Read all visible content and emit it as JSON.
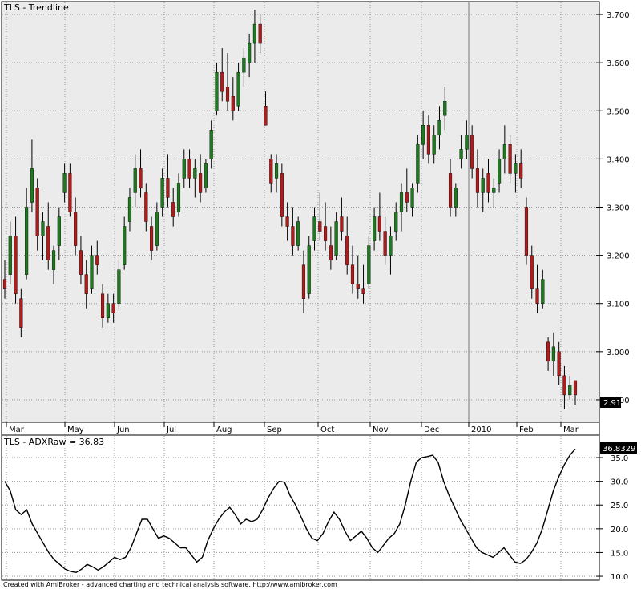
{
  "footer": "Created with AmiBroker - advanced charting and technical analysis software. http://www.amibroker.com",
  "colors": {
    "up": "#1f7a1f",
    "down": "#b01c1c",
    "wick": "#000000",
    "panel": "#ebebeb",
    "grid": "#9a9a9a"
  },
  "chart_data": [
    {
      "type": "candlestick",
      "title": "TLS - Trendline",
      "y_range": [
        2.86,
        3.72
      ],
      "y_ticks": [
        2.9,
        3.0,
        3.1,
        3.2,
        3.3,
        3.4,
        3.5,
        3.6,
        3.7
      ],
      "y_tick_labels": [
        "2.900",
        "3.000",
        "3.100",
        "3.200",
        "3.300",
        "3.400",
        "3.500",
        "3.600",
        "3.700"
      ],
      "x_labels": [
        "Mar",
        "May",
        "Jun",
        "Jul",
        "Aug",
        "Sep",
        "Oct",
        "Nov",
        "Dec",
        "2010",
        "Feb",
        "Mar"
      ],
      "last_value": "2.91",
      "series": [
        {
          "o": 3.15,
          "h": 3.19,
          "l": 3.11,
          "c": 3.13
        },
        {
          "o": 3.16,
          "h": 3.27,
          "l": 3.14,
          "c": 3.24
        },
        {
          "o": 3.24,
          "h": 3.28,
          "l": 3.1,
          "c": 3.12
        },
        {
          "o": 3.11,
          "h": 3.13,
          "l": 3.03,
          "c": 3.05
        },
        {
          "o": 3.16,
          "h": 3.34,
          "l": 3.15,
          "c": 3.3
        },
        {
          "o": 3.31,
          "h": 3.44,
          "l": 3.29,
          "c": 3.38
        },
        {
          "o": 3.34,
          "h": 3.36,
          "l": 3.21,
          "c": 3.24
        },
        {
          "o": 3.24,
          "h": 3.29,
          "l": 3.19,
          "c": 3.27
        },
        {
          "o": 3.26,
          "h": 3.31,
          "l": 3.17,
          "c": 3.19
        },
        {
          "o": 3.17,
          "h": 3.22,
          "l": 3.14,
          "c": 3.21
        },
        {
          "o": 3.22,
          "h": 3.3,
          "l": 3.19,
          "c": 3.28
        },
        {
          "o": 3.33,
          "h": 3.39,
          "l": 3.31,
          "c": 3.37
        },
        {
          "o": 3.37,
          "h": 3.39,
          "l": 3.28,
          "c": 3.29
        },
        {
          "o": 3.29,
          "h": 3.32,
          "l": 3.2,
          "c": 3.22
        },
        {
          "o": 3.21,
          "h": 3.24,
          "l": 3.14,
          "c": 3.16
        },
        {
          "o": 3.16,
          "h": 3.19,
          "l": 3.09,
          "c": 3.12
        },
        {
          "o": 3.13,
          "h": 3.22,
          "l": 3.12,
          "c": 3.2
        },
        {
          "o": 3.2,
          "h": 3.23,
          "l": 3.16,
          "c": 3.18
        },
        {
          "o": 3.12,
          "h": 3.14,
          "l": 3.05,
          "c": 3.07
        },
        {
          "o": 3.07,
          "h": 3.12,
          "l": 3.06,
          "c": 3.1
        },
        {
          "o": 3.1,
          "h": 3.12,
          "l": 3.06,
          "c": 3.08
        },
        {
          "o": 3.1,
          "h": 3.19,
          "l": 3.09,
          "c": 3.17
        },
        {
          "o": 3.18,
          "h": 3.28,
          "l": 3.17,
          "c": 3.26
        },
        {
          "o": 3.27,
          "h": 3.34,
          "l": 3.25,
          "c": 3.32
        },
        {
          "o": 3.33,
          "h": 3.41,
          "l": 3.3,
          "c": 3.38
        },
        {
          "o": 3.38,
          "h": 3.42,
          "l": 3.32,
          "c": 3.34
        },
        {
          "o": 3.33,
          "h": 3.35,
          "l": 3.25,
          "c": 3.27
        },
        {
          "o": 3.26,
          "h": 3.28,
          "l": 3.19,
          "c": 3.21
        },
        {
          "o": 3.22,
          "h": 3.31,
          "l": 3.21,
          "c": 3.29
        },
        {
          "o": 3.3,
          "h": 3.38,
          "l": 3.28,
          "c": 3.36
        },
        {
          "o": 3.36,
          "h": 3.41,
          "l": 3.3,
          "c": 3.32
        },
        {
          "o": 3.31,
          "h": 3.34,
          "l": 3.26,
          "c": 3.28
        },
        {
          "o": 3.29,
          "h": 3.37,
          "l": 3.28,
          "c": 3.35
        },
        {
          "o": 3.36,
          "h": 3.42,
          "l": 3.34,
          "c": 3.4
        },
        {
          "o": 3.4,
          "h": 3.42,
          "l": 3.34,
          "c": 3.36
        },
        {
          "o": 3.36,
          "h": 3.4,
          "l": 3.32,
          "c": 3.38
        },
        {
          "o": 3.37,
          "h": 3.41,
          "l": 3.31,
          "c": 3.33
        },
        {
          "o": 3.34,
          "h": 3.4,
          "l": 3.33,
          "c": 3.39
        },
        {
          "o": 3.4,
          "h": 3.48,
          "l": 3.38,
          "c": 3.46
        },
        {
          "o": 3.5,
          "h": 3.6,
          "l": 3.49,
          "c": 3.58
        },
        {
          "o": 3.58,
          "h": 3.63,
          "l": 3.52,
          "c": 3.54
        },
        {
          "o": 3.55,
          "h": 3.62,
          "l": 3.5,
          "c": 3.52
        },
        {
          "o": 3.53,
          "h": 3.57,
          "l": 3.48,
          "c": 3.5
        },
        {
          "o": 3.51,
          "h": 3.6,
          "l": 3.5,
          "c": 3.58
        },
        {
          "o": 3.58,
          "h": 3.63,
          "l": 3.55,
          "c": 3.61
        },
        {
          "o": 3.6,
          "h": 3.66,
          "l": 3.57,
          "c": 3.64
        },
        {
          "o": 3.64,
          "h": 3.71,
          "l": 3.6,
          "c": 3.68
        },
        {
          "o": 3.68,
          "h": 3.7,
          "l": 3.62,
          "c": 3.64
        },
        {
          "o": 3.51,
          "h": 3.54,
          "l": 3.47,
          "c": 3.47
        },
        {
          "o": 3.4,
          "h": 3.41,
          "l": 3.33,
          "c": 3.35
        },
        {
          "o": 3.36,
          "h": 3.41,
          "l": 3.33,
          "c": 3.39
        },
        {
          "o": 3.37,
          "h": 3.39,
          "l": 3.26,
          "c": 3.28
        },
        {
          "o": 3.28,
          "h": 3.31,
          "l": 3.23,
          "c": 3.26
        },
        {
          "o": 3.26,
          "h": 3.3,
          "l": 3.2,
          "c": 3.22
        },
        {
          "o": 3.22,
          "h": 3.28,
          "l": 3.21,
          "c": 3.27
        },
        {
          "o": 3.18,
          "h": 3.21,
          "l": 3.08,
          "c": 3.11
        },
        {
          "o": 3.12,
          "h": 3.24,
          "l": 3.11,
          "c": 3.22
        },
        {
          "o": 3.23,
          "h": 3.3,
          "l": 3.21,
          "c": 3.28
        },
        {
          "o": 3.27,
          "h": 3.33,
          "l": 3.23,
          "c": 3.25
        },
        {
          "o": 3.26,
          "h": 3.31,
          "l": 3.21,
          "c": 3.23
        },
        {
          "o": 3.22,
          "h": 3.26,
          "l": 3.17,
          "c": 3.19
        },
        {
          "o": 3.2,
          "h": 3.29,
          "l": 3.19,
          "c": 3.27
        },
        {
          "o": 3.28,
          "h": 3.32,
          "l": 3.23,
          "c": 3.25
        },
        {
          "o": 3.24,
          "h": 3.28,
          "l": 3.16,
          "c": 3.18
        },
        {
          "o": 3.18,
          "h": 3.22,
          "l": 3.12,
          "c": 3.14
        },
        {
          "o": 3.14,
          "h": 3.2,
          "l": 3.11,
          "c": 3.13
        },
        {
          "o": 3.13,
          "h": 3.18,
          "l": 3.1,
          "c": 3.12
        },
        {
          "o": 3.14,
          "h": 3.24,
          "l": 3.13,
          "c": 3.22
        },
        {
          "o": 3.23,
          "h": 3.3,
          "l": 3.21,
          "c": 3.28
        },
        {
          "o": 3.28,
          "h": 3.33,
          "l": 3.23,
          "c": 3.25
        },
        {
          "o": 3.25,
          "h": 3.28,
          "l": 3.18,
          "c": 3.2
        },
        {
          "o": 3.2,
          "h": 3.26,
          "l": 3.16,
          "c": 3.24
        },
        {
          "o": 3.25,
          "h": 3.31,
          "l": 3.23,
          "c": 3.29
        },
        {
          "o": 3.29,
          "h": 3.35,
          "l": 3.25,
          "c": 3.33
        },
        {
          "o": 3.33,
          "h": 3.38,
          "l": 3.29,
          "c": 3.31
        },
        {
          "o": 3.3,
          "h": 3.35,
          "l": 3.28,
          "c": 3.34
        },
        {
          "o": 3.35,
          "h": 3.45,
          "l": 3.33,
          "c": 3.43
        },
        {
          "o": 3.43,
          "h": 3.5,
          "l": 3.4,
          "c": 3.47
        },
        {
          "o": 3.47,
          "h": 3.49,
          "l": 3.39,
          "c": 3.41
        },
        {
          "o": 3.41,
          "h": 3.47,
          "l": 3.39,
          "c": 3.45
        },
        {
          "o": 3.45,
          "h": 3.51,
          "l": 3.42,
          "c": 3.48
        },
        {
          "o": 3.49,
          "h": 3.55,
          "l": 3.46,
          "c": 3.52
        },
        {
          "o": 3.37,
          "h": 3.4,
          "l": 3.28,
          "c": 3.3
        },
        {
          "o": 3.3,
          "h": 3.35,
          "l": 3.28,
          "c": 3.34
        },
        {
          "o": 3.4,
          "h": 3.45,
          "l": 3.38,
          "c": 3.42
        },
        {
          "o": 3.42,
          "h": 3.48,
          "l": 3.4,
          "c": 3.45
        },
        {
          "o": 3.45,
          "h": 3.47,
          "l": 3.36,
          "c": 3.38
        },
        {
          "o": 3.38,
          "h": 3.42,
          "l": 3.3,
          "c": 3.33
        },
        {
          "o": 3.33,
          "h": 3.38,
          "l": 3.29,
          "c": 3.36
        },
        {
          "o": 3.37,
          "h": 3.4,
          "l": 3.31,
          "c": 3.33
        },
        {
          "o": 3.33,
          "h": 3.36,
          "l": 3.3,
          "c": 3.34
        },
        {
          "o": 3.35,
          "h": 3.42,
          "l": 3.33,
          "c": 3.4
        },
        {
          "o": 3.4,
          "h": 3.47,
          "l": 3.37,
          "c": 3.43
        },
        {
          "o": 3.43,
          "h": 3.45,
          "l": 3.35,
          "c": 3.37
        },
        {
          "o": 3.37,
          "h": 3.41,
          "l": 3.33,
          "c": 3.39
        },
        {
          "o": 3.39,
          "h": 3.42,
          "l": 3.34,
          "c": 3.36
        },
        {
          "o": 3.3,
          "h": 3.32,
          "l": 3.18,
          "c": 3.2
        },
        {
          "o": 3.2,
          "h": 3.22,
          "l": 3.11,
          "c": 3.13
        },
        {
          "o": 3.13,
          "h": 3.18,
          "l": 3.08,
          "c": 3.1
        },
        {
          "o": 3.1,
          "h": 3.17,
          "l": 3.09,
          "c": 3.15
        },
        {
          "o": 3.02,
          "h": 3.03,
          "l": 2.96,
          "c": 2.98
        },
        {
          "o": 2.98,
          "h": 3.04,
          "l": 2.95,
          "c": 3.01
        },
        {
          "o": 3.0,
          "h": 3.02,
          "l": 2.93,
          "c": 2.95
        },
        {
          "o": 2.95,
          "h": 2.97,
          "l": 2.88,
          "c": 2.91
        },
        {
          "o": 2.91,
          "h": 2.95,
          "l": 2.9,
          "c": 2.93
        },
        {
          "o": 2.94,
          "h": 2.94,
          "l": 2.89,
          "c": 2.91
        }
      ]
    },
    {
      "type": "line",
      "title": "TLS - ADXRaw = 36.83",
      "y_range": [
        9.5,
        37.2
      ],
      "y_ticks": [
        10,
        15,
        20,
        25,
        30,
        35
      ],
      "y_tick_labels": [
        "10.0",
        "15.0",
        "20.0",
        "25.0",
        "30.0",
        "35.0"
      ],
      "last_value": "36.8329",
      "series": [
        {
          "values": [
            30.0,
            28.0,
            24.0,
            23.0,
            24.0,
            21.0,
            19.0,
            17.0,
            15.0,
            13.5,
            12.5,
            11.5,
            11.0,
            10.8,
            11.5,
            12.5,
            12.0,
            11.3,
            12.0,
            13.0,
            14.0,
            13.5,
            14.0,
            16.0,
            19.0,
            22.0,
            22.0,
            20.0,
            18.0,
            18.5,
            18.0,
            17.0,
            16.0,
            16.0,
            14.5,
            13.0,
            14.0,
            17.5,
            20.0,
            22.0,
            23.5,
            24.5,
            23.0,
            21.0,
            22.0,
            21.5,
            22.0,
            24.0,
            26.5,
            28.5,
            30.0,
            29.8,
            27.0,
            25.0,
            22.5,
            20.0,
            18.0,
            17.5,
            19.0,
            21.5,
            23.5,
            22.0,
            19.5,
            17.5,
            18.5,
            19.5,
            18.0,
            16.0,
            15.0,
            16.5,
            18.0,
            19.0,
            21.0,
            25.0,
            30.0,
            34.0,
            35.0,
            35.2,
            35.5,
            34.0,
            30.0,
            27.0,
            24.5,
            22.0,
            20.0,
            18.0,
            16.0,
            15.0,
            14.5,
            14.0,
            15.0,
            16.0,
            14.5,
            13.0,
            12.7,
            13.5,
            15.0,
            17.0,
            20.0,
            24.0,
            28.0,
            31.0,
            33.5,
            35.5,
            36.83
          ]
        }
      ]
    }
  ]
}
